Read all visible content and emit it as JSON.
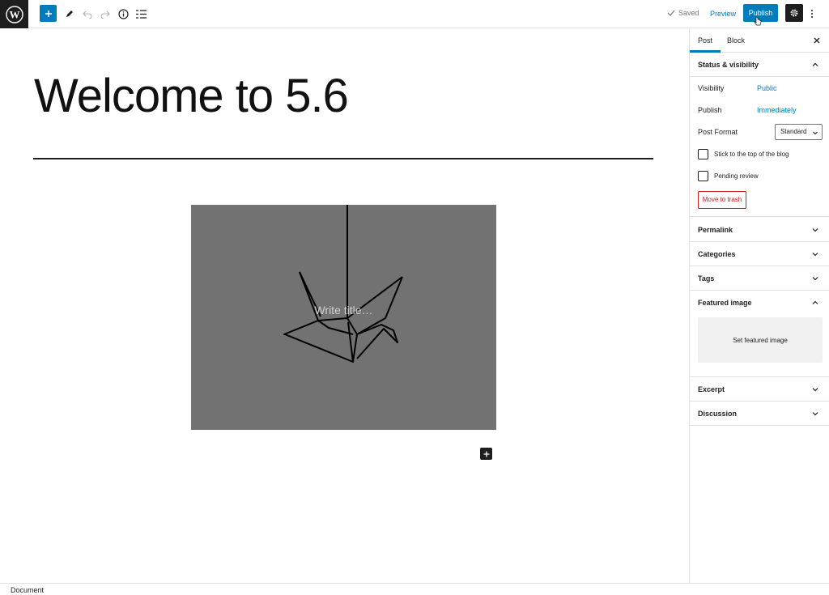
{
  "toolbar": {
    "saved_label": "Saved",
    "preview_label": "Preview",
    "publish_label": "Publish"
  },
  "editor": {
    "post_title": "Welcome to 5.6",
    "cover_placeholder": "Write title…"
  },
  "sidebar": {
    "tabs": [
      {
        "label": "Post",
        "active": true
      },
      {
        "label": "Block",
        "active": false
      }
    ],
    "status_panel": {
      "title": "Status & visibility",
      "visibility_label": "Visibility",
      "visibility_value": "Public",
      "publish_label": "Publish",
      "publish_value": "Immediately",
      "post_format_label": "Post Format",
      "post_format_value": "Standard",
      "sticky_label": "Stick to the top of the blog",
      "pending_label": "Pending review",
      "trash_label": "Move to trash"
    },
    "panels": {
      "permalink": "Permalink",
      "categories": "Categories",
      "tags": "Tags",
      "featured_image": "Featured image",
      "featured_button": "Set featured image",
      "excerpt": "Excerpt",
      "discussion": "Discussion"
    }
  },
  "footer": {
    "breadcrumb": "Document"
  },
  "colors": {
    "accent": "#007cba",
    "danger": "#cc1818",
    "dark": "#1e1e1e"
  }
}
